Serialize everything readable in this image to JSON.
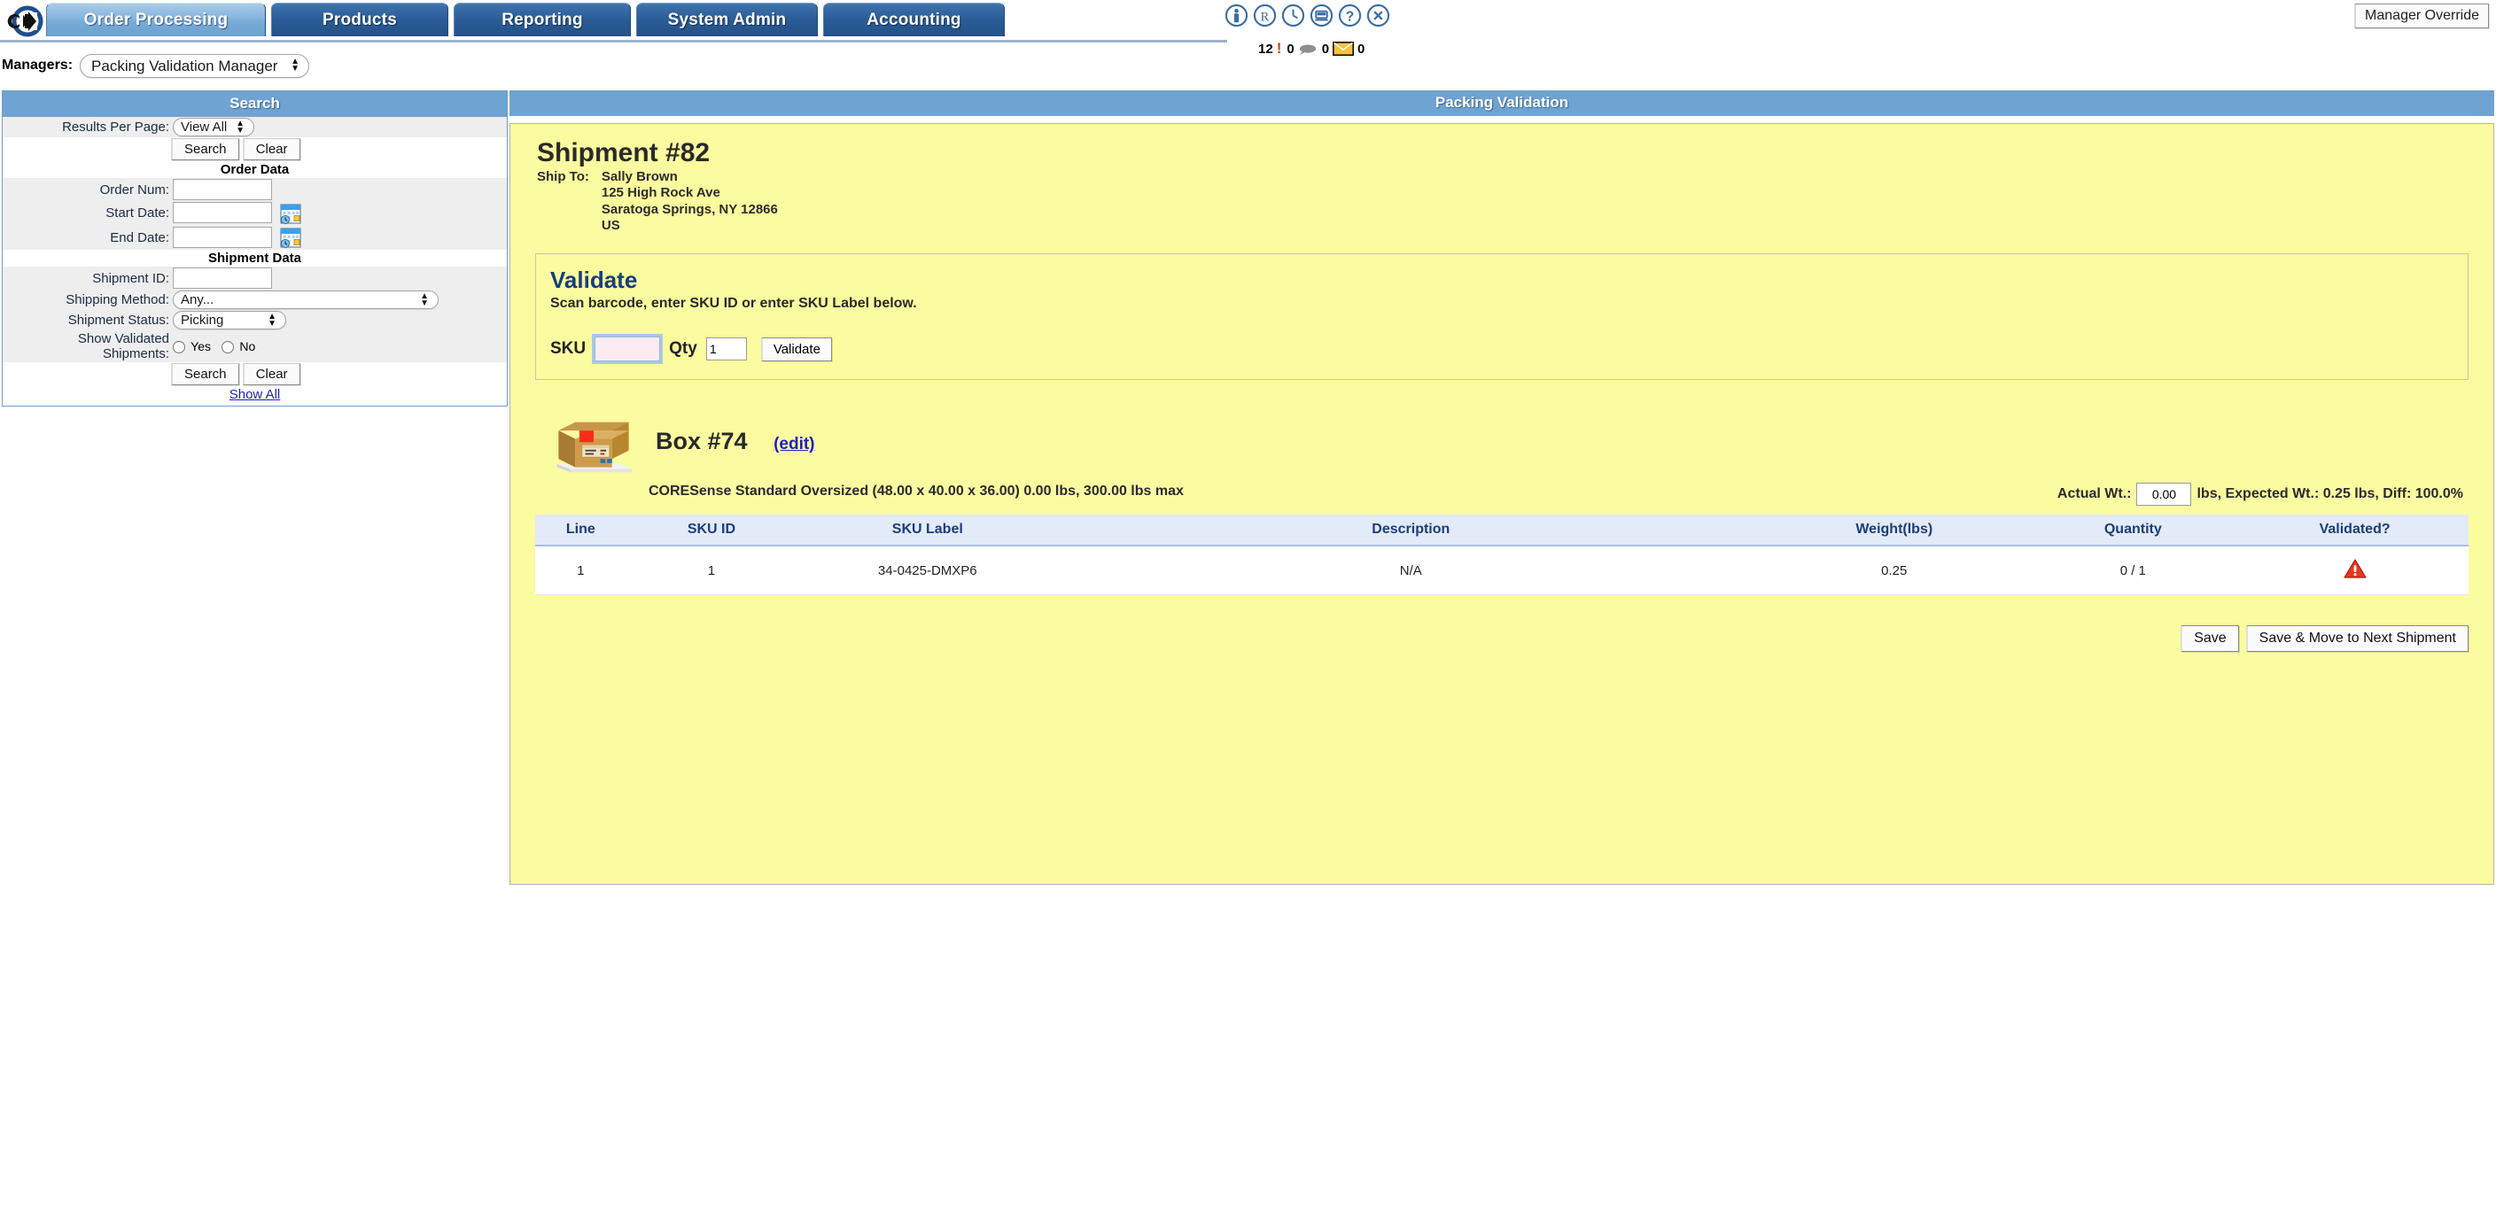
{
  "app": {
    "logo_icon": "arrow-circle-logo",
    "manager_override_label": "Manager Override"
  },
  "nav": {
    "tabs": [
      {
        "label": "Order Processing",
        "active": true
      },
      {
        "label": "Products",
        "active": false
      },
      {
        "label": "Reporting",
        "active": false
      },
      {
        "label": "System Admin",
        "active": false
      },
      {
        "label": "Accounting",
        "active": false
      }
    ],
    "icons": [
      {
        "name": "person-info-icon",
        "glyph": "i"
      },
      {
        "name": "registered-r-icon",
        "glyph": "R"
      },
      {
        "name": "clock-icon",
        "glyph": "clock"
      },
      {
        "name": "monitor-screen-icon",
        "glyph": "screen"
      },
      {
        "name": "help-question-icon",
        "glyph": "?"
      },
      {
        "name": "close-x-icon",
        "glyph": "x"
      }
    ],
    "status_counts": {
      "alerts": "12",
      "chats": "0",
      "mail_left": "0",
      "mail_right": "0"
    }
  },
  "managers": {
    "label": "Managers:",
    "selected": "Packing Validation Manager",
    "options": [
      "Packing Validation Manager"
    ]
  },
  "search": {
    "header": "Search",
    "results_per_page_label": "Results Per Page:",
    "results_per_page_value": "View All",
    "results_per_page_options": [
      "View All"
    ],
    "top_search_button": "Search",
    "top_clear_button": "Clear",
    "order_data_title": "Order Data",
    "order_num_label": "Order Num:",
    "order_num_value": "",
    "start_date_label": "Start Date:",
    "start_date_value": "",
    "end_date_label": "End Date:",
    "end_date_value": "",
    "shipment_data_title": "Shipment Data",
    "shipment_id_label": "Shipment ID:",
    "shipment_id_value": "",
    "shipping_method_label": "Shipping Method:",
    "shipping_method_value": "Any...",
    "shipping_method_options": [
      "Any..."
    ],
    "shipment_status_label": "Shipment Status:",
    "shipment_status_value": "Picking",
    "shipment_status_options": [
      "Picking"
    ],
    "show_validated_label_line1": "Show Validated",
    "show_validated_label_line2": "Shipments:",
    "radio_yes": "Yes",
    "radio_no": "No",
    "bottom_search_button": "Search",
    "bottom_clear_button": "Clear",
    "show_all_link": "Show All"
  },
  "main": {
    "header": "Packing Validation",
    "shipment_title": "Shipment #82",
    "ship_to_label": "Ship To:",
    "ship_to_address": [
      "Sally Brown",
      "125 High Rock Ave",
      "Saratoga Springs, NY 12866",
      "US"
    ],
    "validate": {
      "title": "Validate",
      "subtitle": "Scan barcode, enter SKU ID or enter SKU Label below.",
      "sku_label": "SKU",
      "sku_value": "",
      "qty_label": "Qty",
      "qty_value": "1",
      "validate_button": "Validate"
    },
    "box": {
      "icon": "cardboard-box-icon",
      "title": "Box #74",
      "edit_link": "(edit)",
      "dimensions": "CORESense Standard Oversized (48.00 x 40.00 x 36.00) 0.00 lbs, 300.00 lbs max",
      "actual_wt_label": "Actual Wt.:",
      "actual_wt_value": "0.00",
      "weight_summary": "lbs, Expected Wt.: 0.25 lbs, Diff: 100.0%"
    },
    "table": {
      "columns": [
        "Line",
        "SKU ID",
        "SKU Label",
        "Description",
        "Weight(lbs)",
        "Quantity",
        "Validated?"
      ],
      "rows": [
        {
          "line": "1",
          "sku_id": "1",
          "sku_label": "34-0425-DMXP6",
          "description": "N/A",
          "weight": "0.25",
          "quantity": "0 / 1",
          "validated_icon": "warning-triangle-icon"
        }
      ]
    },
    "footer": {
      "save_button": "Save",
      "save_next_button": "Save & Move to Next Shipment"
    }
  },
  "colors": {
    "tab_active": "#85b4dd",
    "tab_inactive": "#2b5d98",
    "panel_header": "#6fa3d2",
    "yellow_bg": "#fbfba0",
    "heading_blue": "#1b3d7a",
    "link_blue": "#2020c0",
    "warning_red": "#e8361c"
  }
}
